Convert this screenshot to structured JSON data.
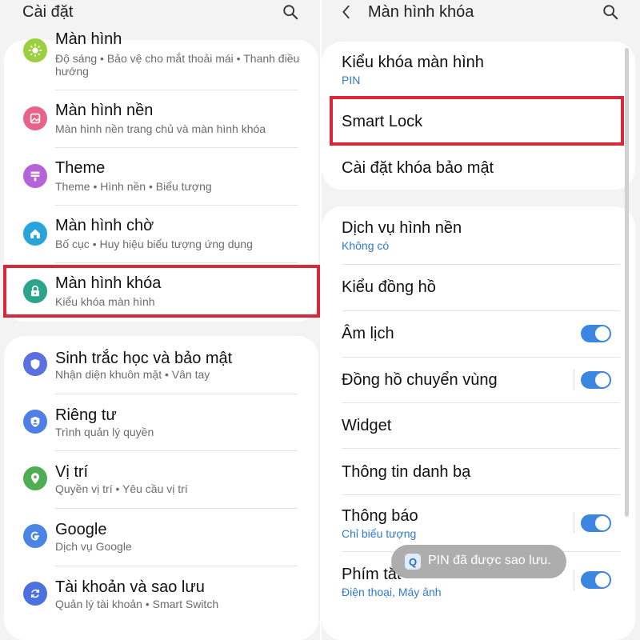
{
  "left": {
    "title": "Cài đặt",
    "items": [
      {
        "title": "Màn hình",
        "subtitle": "Độ sáng  •  Bảo vệ cho mắt thoải mái  •  Thanh điều",
        "subtitle2": "hướng",
        "icon": "sun-icon",
        "color": "#9bcf3f"
      },
      {
        "title": "Màn hình nền",
        "subtitle": "Màn hình nền trang chủ và màn hình khóa",
        "icon": "wallpaper-icon",
        "color": "#e76389"
      },
      {
        "title": "Theme",
        "subtitle": "Theme  •  Hình nền  •  Biểu tượng",
        "icon": "theme-icon",
        "color": "#b563d8"
      },
      {
        "title": "Màn hình chờ",
        "subtitle": "Bố cục  •  Huy hiệu biểu tượng ứng dụng",
        "icon": "home-icon",
        "color": "#27a4dc"
      },
      {
        "title": "Màn hình khóa",
        "subtitle": "Kiểu khóa màn hình",
        "icon": "lock-icon",
        "color": "#2aa58c"
      },
      {
        "title": "Sinh trắc học và bảo mật",
        "subtitle": "Nhận diện khuôn mặt  •  Vân tay",
        "icon": "shield-icon",
        "color": "#5a6fe0"
      },
      {
        "title": "Riêng tư",
        "subtitle": "Trình quản lý quyền",
        "icon": "privacy-icon",
        "color": "#4d7fe6"
      },
      {
        "title": "Vị trí",
        "subtitle": "Quyền vị trí  •  Yêu cầu vị trí",
        "icon": "location-icon",
        "color": "#4fae54"
      },
      {
        "title": "Google",
        "subtitle": "Dịch vụ Google",
        "icon": "google-icon",
        "color": "#4a85e6"
      },
      {
        "title": "Tài khoản và sao lưu",
        "subtitle": "Quản lý tài khoản  •  Smart Switch",
        "icon": "sync-icon",
        "color": "#4b71e0"
      }
    ]
  },
  "right": {
    "title": "Màn hình khóa",
    "items": [
      {
        "title": "Kiểu khóa màn hình",
        "subtitle": "PIN"
      },
      {
        "title": "Smart Lock"
      },
      {
        "title": "Cài đặt khóa bảo mật"
      },
      {
        "title": "Dịch vụ hình nền",
        "subtitle": "Không có"
      },
      {
        "title": "Kiểu đồng hồ"
      },
      {
        "title": "Âm lịch",
        "toggle": true
      },
      {
        "title": "Đồng hồ chuyển vùng",
        "toggle": true
      },
      {
        "title": "Widget"
      },
      {
        "title": "Thông tin danh bạ"
      },
      {
        "title": "Thông báo",
        "subtitle": "Chỉ biểu tượng",
        "toggle": true
      },
      {
        "title": "Phím tắt",
        "subtitle": "Điện thoại, Máy ảnh",
        "toggle": true
      }
    ]
  },
  "toast": {
    "icon_letter": "Q",
    "text": "PIN đã được sao lưu."
  },
  "colors": {
    "highlight": "#d9283a",
    "toggle_on": "#3d86e0",
    "link_blue": "#2f7bd0"
  }
}
